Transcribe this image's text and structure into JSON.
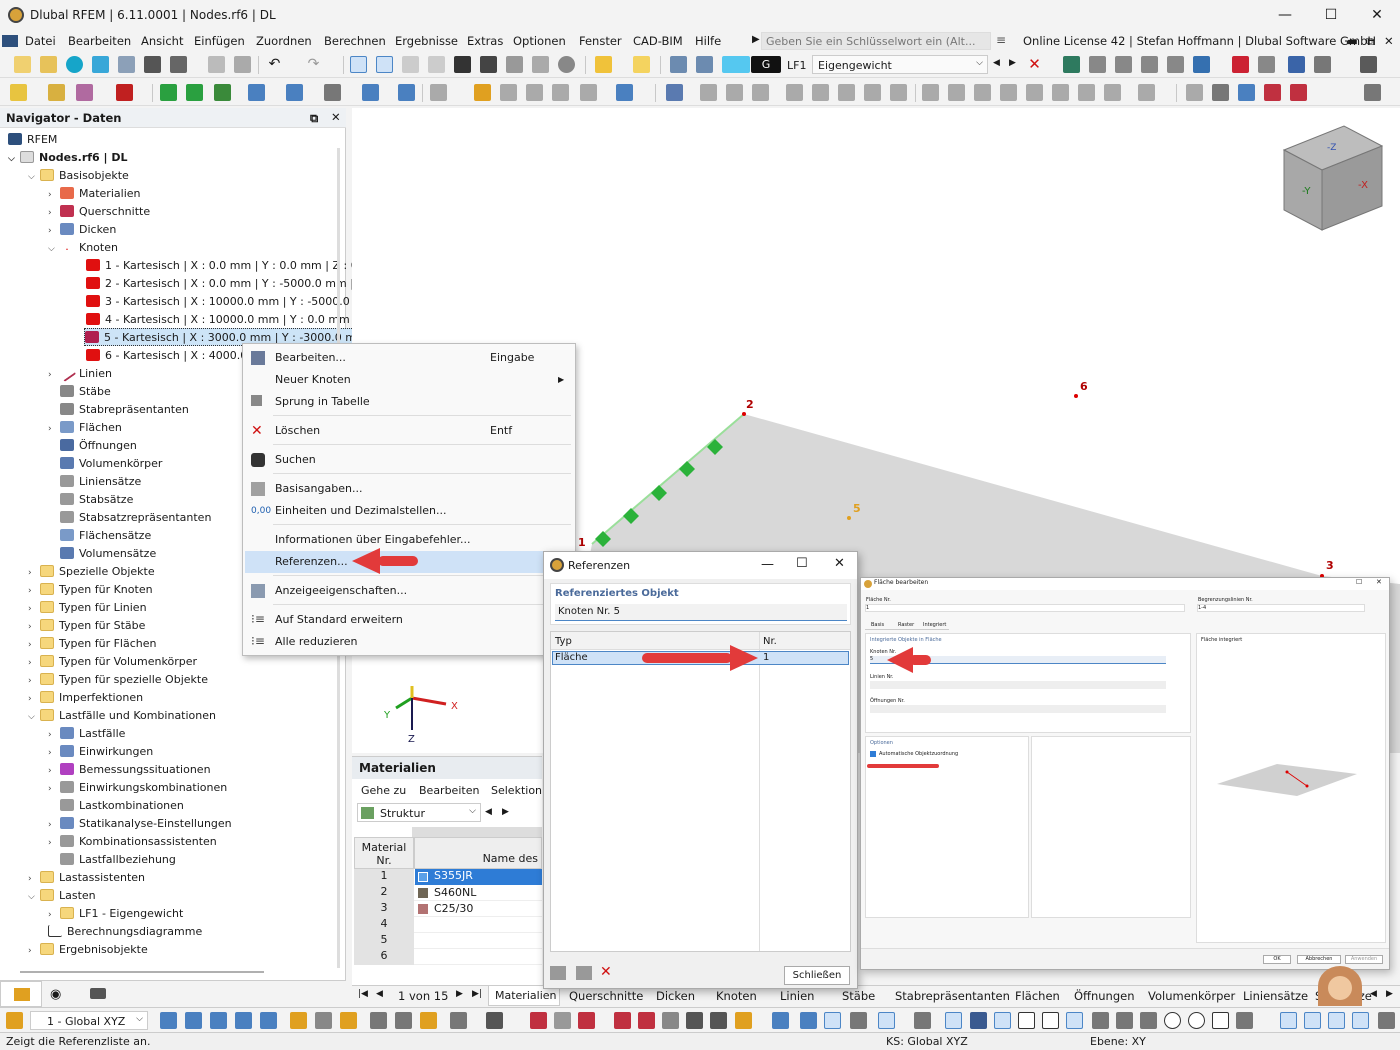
{
  "window": {
    "title": "Dlubal RFEM | 6.11.0001 | Nodes.rf6 | DL"
  },
  "menu": {
    "items": [
      "Datei",
      "Bearbeiten",
      "Ansicht",
      "Einfügen",
      "Zuordnen",
      "Berechnen",
      "Ergebnisse",
      "Extras",
      "Optionen",
      "Fenster",
      "CAD-BIM",
      "Hilfe"
    ],
    "search_placeholder": "Geben Sie ein Schlüsselwort ein (Alt...",
    "license": "Online License 42 | Stefan Hoffmann | Dlubal Software GmbH"
  },
  "toolbar": {
    "lc_code": "G",
    "lc_id": "LF1",
    "lc_name": "Eigengewicht"
  },
  "navigator": {
    "title": "Navigator - Daten",
    "root": "RFEM",
    "file": "Nodes.rf6 | DL",
    "basis": "Basisobjekte",
    "items_basis": [
      "Materialien",
      "Querschnitte",
      "Dicken",
      "Knoten"
    ],
    "nodes": [
      "1 - Kartesisch | X : 0.0 mm | Y : 0.0 mm | Z : 0.0",
      "2 - Kartesisch | X : 0.0 mm | Y : -5000.0 mm | Z :",
      "3 - Kartesisch | X : 10000.0 mm | Y : -5000.0 mr",
      "4 - Kartesisch | X : 10000.0 mm | Y : 0.0 mm | Z",
      "5 - Kartesisch | X : 3000.0 mm | Y : -3000.0 mm",
      "6 - Kartesisch | X : 4000.0 mi"
    ],
    "items_basis2": [
      "Linien",
      "Stäbe",
      "Stabrepräsentanten",
      "Flächen",
      "Öffnungen",
      "Volumenkörper",
      "Liniensätze",
      "Stabsätze",
      "Stabsatzrepräsentanten",
      "Flächensätze",
      "Volumensätze"
    ],
    "folders": [
      "Spezielle Objekte",
      "Typen für Knoten",
      "Typen für Linien",
      "Typen für Stäbe",
      "Typen für Flächen",
      "Typen für Volumenkörper",
      "Typen für spezielle Objekte",
      "Imperfektionen",
      "Lastfälle und Kombinationen"
    ],
    "lf_items": [
      "Lastfälle",
      "Einwirkungen",
      "Bemessungssituationen",
      "Einwirkungskombinationen",
      "Lastkombinationen",
      "Statikanalyse-Einstellungen",
      "Kombinationsassistenten",
      "Lastfallbeziehung"
    ],
    "folders2": [
      "Lastassistenten",
      "Lasten"
    ],
    "lasten_items": [
      "LF1 - Eigengewicht"
    ],
    "rest": [
      "Berechnungsdiagramme",
      "Ergebnisobjekte"
    ]
  },
  "context_menu": [
    {
      "label": "Bearbeiten...",
      "key": "Eingabe"
    },
    {
      "label": "Neuer Knoten",
      "key": ""
    },
    {
      "label": "Sprung in Tabelle",
      "key": ""
    },
    {
      "label": "Löschen",
      "key": "Entf"
    },
    {
      "label": "Suchen",
      "key": ""
    },
    {
      "label": "Basisangaben...",
      "key": ""
    },
    {
      "label": "Einheiten und Dezimalstellen...",
      "key": ""
    },
    {
      "label": "Informationen über Eingabefehler...",
      "key": ""
    },
    {
      "label": "Referenzen...",
      "key": ""
    },
    {
      "label": "Anzeigeeigenschaften...",
      "key": ""
    },
    {
      "label": "Auf Standard erweitern",
      "key": ""
    },
    {
      "label": "Alle reduzieren",
      "key": ""
    }
  ],
  "ref_dialog": {
    "title": "Referenzen",
    "section": "Referenziertes Objekt",
    "object": "Knoten Nr. 5",
    "col_type": "Typ",
    "col_nr": "Nr.",
    "row_type": "Fläche",
    "row_nr": "1",
    "close": "Schließen"
  },
  "surface_dialog": {
    "title": "Fläche bearbeiten",
    "flaeche_nr": "Fläche Nr.",
    "flaeche_val": "1",
    "begr_label": "Begrenzungslinien Nr.",
    "begr_val": "1-4",
    "tabs": [
      "Basis",
      "Raster",
      "Integriert"
    ],
    "section": "Integrierte Objekte in Fläche",
    "knoten_label": "Knoten Nr.",
    "knoten_val": "5",
    "linien_label": "Linien Nr.",
    "oeff_label": "Öffnungen Nr.",
    "options": "Optionen",
    "auto": "Automatische Objektzuordnung",
    "right_title": "Fläche integriert",
    "ok": "OK",
    "cancel": "Abbrechen",
    "apply": "Anwenden"
  },
  "viewport": {
    "node_labels": [
      "2",
      "6",
      "5",
      "1",
      "3"
    ],
    "axes": {
      "x": "X",
      "y": "Y",
      "z": "Z"
    }
  },
  "materials": {
    "title": "Materialien",
    "menu": [
      "Gehe zu",
      "Bearbeiten",
      "Selektion"
    ],
    "view": "Struktur",
    "col_nr": "Material Nr.",
    "col_name": "Name des",
    "rows": [
      {
        "nr": "1",
        "name": "S355JR",
        "color": "#2e7cd6"
      },
      {
        "nr": "2",
        "name": "S460NL",
        "color": "#6f6655"
      },
      {
        "nr": "3",
        "name": "C25/30",
        "color": "#b27272"
      },
      {
        "nr": "4",
        "name": "",
        "color": ""
      },
      {
        "nr": "5",
        "name": "",
        "color": ""
      },
      {
        "nr": "6",
        "name": "",
        "color": ""
      }
    ],
    "pager": "1 von 15"
  },
  "bottom_tabs": [
    "Materialien",
    "Querschnitte",
    "Dicken",
    "Knoten",
    "Linien",
    "Stäbe",
    "Stabrepräsentanten",
    "Flächen",
    "Öffnungen",
    "Volumenkörper",
    "Liniensätze",
    "Stabsätze"
  ],
  "bottom_toolbar": {
    "cs": "1 - Global XYZ"
  },
  "status": {
    "left": "Zeigt die Referenzliste an.",
    "cs": "KS: Global XYZ",
    "plane": "Ebene: XY"
  }
}
